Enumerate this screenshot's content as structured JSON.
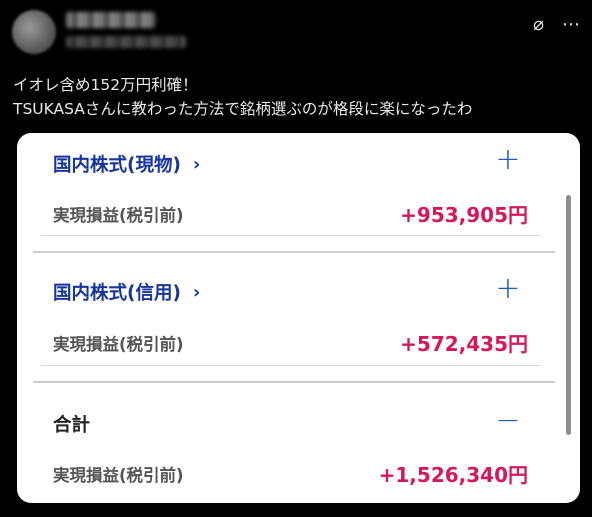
{
  "tweet": {
    "text_line1": "イオレ含め152万円利確！",
    "text_line2": "TSUKASAさんに教わった方法で銘柄選ぶのが格段に楽になったわ"
  },
  "header_icons": [
    "grok-icon",
    "more-icon"
  ],
  "card": {
    "sections": [
      {
        "title": "国内株式(現物)",
        "toggle": "+",
        "row_label": "実現損益(税引前)",
        "value": "+953,905円"
      },
      {
        "title": "国内株式(信用)",
        "toggle": "+",
        "row_label": "実現損益(税引前)",
        "value": "+572,435円"
      },
      {
        "title": "合計",
        "toggle": "−",
        "row_label": "実現損益(税引前)",
        "value": "+1,526,340円"
      }
    ],
    "chevron": "›"
  },
  "colors": {
    "accent": "#17359d",
    "value": "#d6175e",
    "toggle": "#1d5bbf"
  }
}
